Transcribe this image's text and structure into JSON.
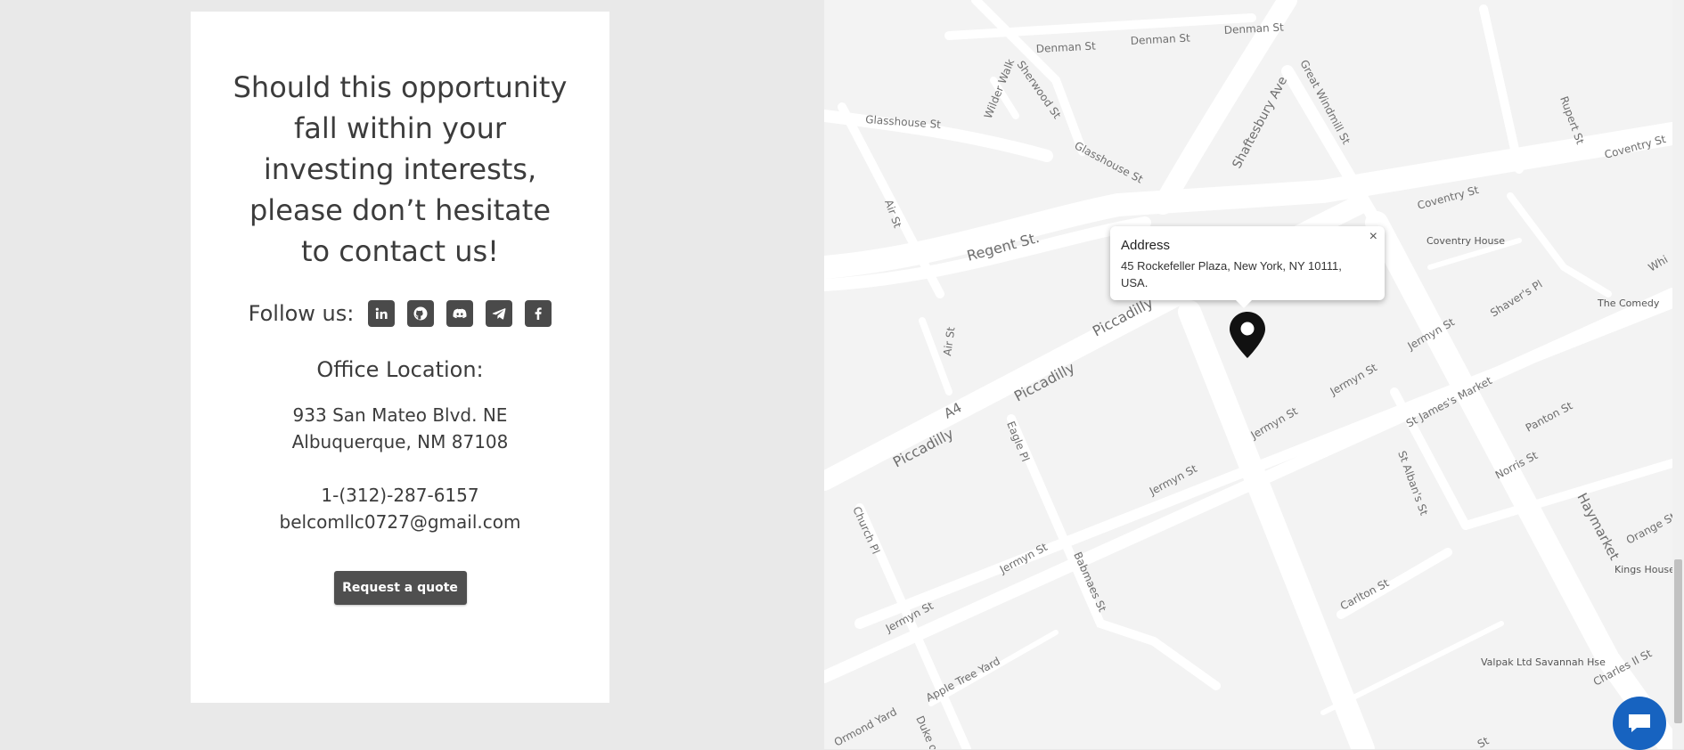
{
  "contact_card": {
    "headline": "Should this opportunity fall within your investing interests, please don’t hesitate to contact us!",
    "follow_label": "Follow us:",
    "social_icons": [
      "linkedin-icon",
      "github-icon",
      "discord-icon",
      "telegram-icon",
      "facebook-icon"
    ],
    "office_title": "Office Location:",
    "address_line1": "933 San Mateo Blvd. NE",
    "address_line2": "Albuquerque, NM 87108",
    "phone": "1-(312)-287-6157",
    "email": "belcomllc0727@gmail.com",
    "quote_button": "Request a quote"
  },
  "map": {
    "popup": {
      "title": "Address",
      "text": "45 Rockefeller Plaza, New York, NY 10111, USA.",
      "close": "×"
    },
    "labels": {
      "denman1": "Denman St",
      "denman2": "Denman St",
      "denman3": "Denman St",
      "shaftesbury": "Shaftesbury Ave",
      "great_windmill": "Great Windmill St",
      "rupert": "Rupert St",
      "coventry1": "Coventry St",
      "coventry2": "Coventry St",
      "glasshouse1": "Glasshouse St",
      "glasshouse2": "Glasshouse St",
      "wilder": "Wilder Walk",
      "sherwood": "Sherwood St",
      "air1": "Air St",
      "air2": "Air St",
      "regent": "Regent St.",
      "coventry_house": "Coventry House",
      "shavers": "Shaver's Pl",
      "comedy": "The Comedy",
      "piccadilly1": "Piccadilly",
      "piccadilly2": "Piccadilly",
      "piccadilly3": "Piccadilly",
      "a4": "A4",
      "jermyn1": "Jermyn St",
      "jermyn2": "Jermyn St",
      "jermyn3": "Jermyn St",
      "jermyn4": "Jermyn St",
      "jermyn5": "Jermyn St",
      "jermyn6": "Jermyn St",
      "eagle": "Eagle Pl",
      "st_jamess_market": "St James's Market",
      "panton": "Panton St",
      "st_albans": "St Alban's St",
      "norris": "Norris St",
      "haymarket": "Haymarket",
      "church": "Church Pl",
      "babmaes": "Babmaes St",
      "carlton": "Carlton St",
      "orange": "Orange St",
      "kings_house": "Kings House H",
      "apple_tree": "Apple Tree Yard",
      "ormond": "Ormond Yard",
      "duke": "Duke o",
      "valpak": "Valpak Ltd Savannah Hse",
      "charles": "Charles II St",
      "whi": "Whi",
      "st_bottom": "St"
    }
  },
  "colors": {
    "page_bg": "#e9e9e9",
    "card_bg": "#ffffff",
    "button_bg": "#4f4f4f",
    "chat_button": "#1763c0",
    "map_bg": "#f3f3f3",
    "road": "#ffffff"
  }
}
